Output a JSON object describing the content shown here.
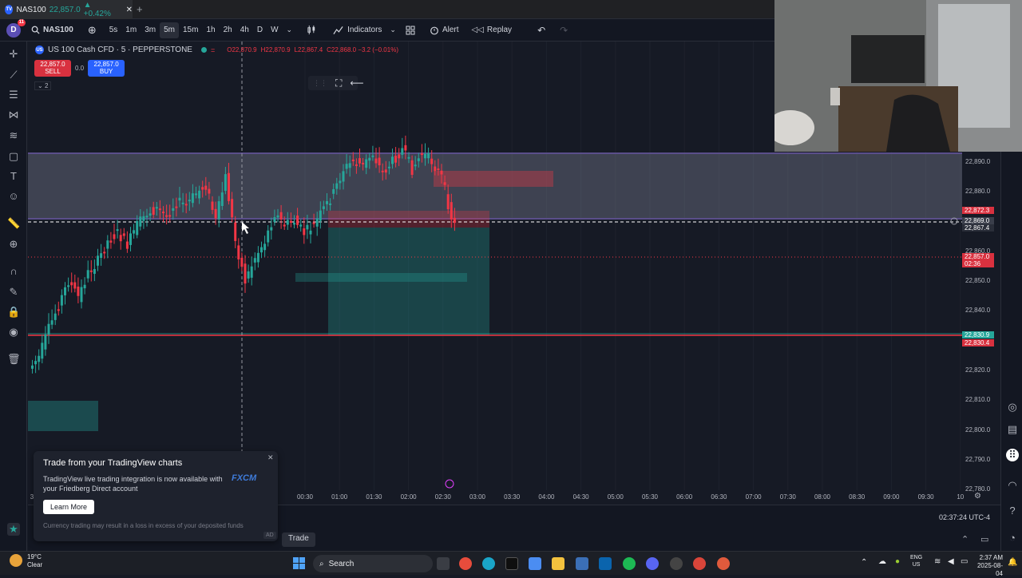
{
  "browser_tab": {
    "title": "NAS100",
    "price": "22,857.0",
    "change": "▲ +0.42%",
    "close": "✕",
    "new_tab": "+"
  },
  "toolbar": {
    "avatar": "D",
    "notif": "11",
    "symbol": "NAS100",
    "intervals": [
      "5s",
      "1m",
      "3m",
      "5m",
      "15m",
      "1h",
      "2h",
      "4h",
      "D",
      "W"
    ],
    "active_interval": "5m",
    "indicators": "Indicators",
    "alert": "Alert",
    "replay": "Replay"
  },
  "legend": {
    "symbol_desc": "US 100 Cash CFD · 5 · PEPPERSTONE",
    "o": "O22,870.9",
    "h": "H22,870.9",
    "l": "L22,867.4",
    "c": "C22,868.0 −3.2 (−0.01%)"
  },
  "trade_buttons": {
    "sell_price": "22,857.0",
    "sell_label": "SELL",
    "spread": "0.0",
    "buy_price": "22,857.0",
    "buy_label": "BUY",
    "collapse": "2"
  },
  "price_axis": {
    "labels": [
      "22,890.0",
      "22,880.0",
      "22,860.0",
      "22,850.0",
      "22,840.0",
      "22,820.0",
      "22,810.0",
      "22,800.0",
      "22,790.0",
      "22,780.0"
    ],
    "tag_red1": "22,872.3",
    "tag_gray": "22,869.0",
    "tag_gray2": "22,867.4",
    "tag_red2": "22,857.0",
    "tag_red2_timer": "02:36",
    "tag_green": "22,830.9",
    "tag_red3": "22,830.4"
  },
  "time_axis": {
    "labels": [
      "00:30",
      "01:00",
      "01:30",
      "02:00",
      "02:30",
      "03:00",
      "03:30",
      "04:00",
      "04:30",
      "05:00",
      "05:30",
      "06:00",
      "06:30",
      "07:00",
      "07:30",
      "08:00",
      "08:30",
      "09:00",
      "09:30",
      "10"
    ],
    "left_stub": "3"
  },
  "clock": "02:37:24 UTC-4",
  "bottom_tab": "Trade",
  "toast": {
    "title": "Trade from your TradingView charts",
    "body": "TradingView live trading integration is now available with your Friedberg Direct account",
    "brand": "FXCM",
    "button": "Learn More",
    "disclaimer": "Currency trading may result in a loss in excess of your deposited funds",
    "ad": "AD"
  },
  "taskbar": {
    "weather_temp": "19°C",
    "weather_desc": "Clear",
    "search": "Search",
    "lang": "ENG",
    "region": "US",
    "time": "2:37 AM",
    "date": "2025-08-04"
  },
  "colors": {
    "bull": "#26a69a",
    "bear": "#f23645",
    "bg": "#161a25",
    "accent": "#2962ff"
  }
}
